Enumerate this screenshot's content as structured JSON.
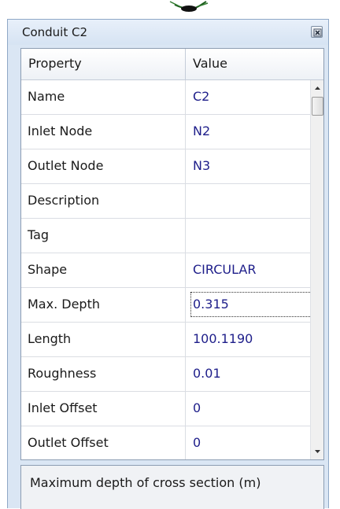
{
  "panel": {
    "title": "Conduit C2"
  },
  "grid": {
    "headers": {
      "property": "Property",
      "value": "Value"
    },
    "rows": [
      {
        "property": "Name",
        "value": "C2"
      },
      {
        "property": "Inlet Node",
        "value": "N2"
      },
      {
        "property": "Outlet Node",
        "value": "N3"
      },
      {
        "property": "Description",
        "value": ""
      },
      {
        "property": "Tag",
        "value": ""
      },
      {
        "property": "Shape",
        "value": "CIRCULAR"
      },
      {
        "property": "Max. Depth",
        "value": "0.315"
      },
      {
        "property": "Length",
        "value": "100.1190"
      },
      {
        "property": "Roughness",
        "value": "0.01"
      },
      {
        "property": "Inlet Offset",
        "value": "0"
      },
      {
        "property": "Outlet Offset",
        "value": "0"
      }
    ],
    "selected_row": "Max. Depth"
  },
  "description_box": {
    "text": "Maximum depth of cross section (m)"
  },
  "icons": {
    "close": "close-icon",
    "scroll_up": "arrow-up-icon",
    "scroll_down": "arrow-down-icon"
  },
  "colors": {
    "value_text": "#1e1e8a",
    "panel_bg": "#dae6f4"
  }
}
